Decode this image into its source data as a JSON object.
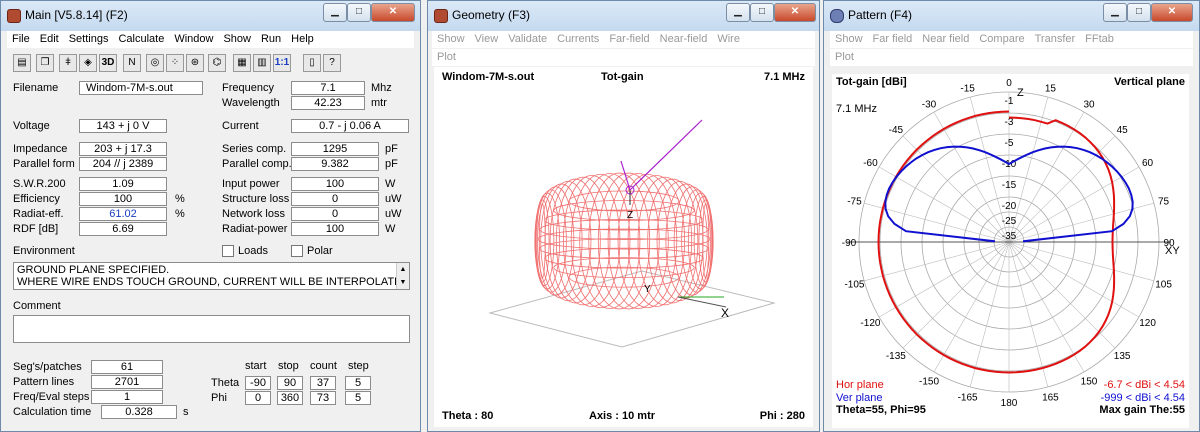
{
  "main": {
    "title": "Main [V5.8.14]  (F2)",
    "menu": [
      "File",
      "Edit",
      "Settings",
      "Calculate",
      "Window",
      "Show",
      "Run",
      "Help"
    ],
    "toolbar_icons": [
      "open-icon",
      "copy-icon",
      "antenna-icon",
      "cube-icon",
      "3d-icon",
      "ng-icon",
      "globe-icon",
      "pattern-icon",
      "target-icon",
      "wire-icon",
      "calc-icon",
      "swr-icon",
      "ratio-icon",
      "book-icon",
      "help-icon"
    ],
    "toolbar_text": {
      "3d": "3D",
      "ratio": "1:1"
    },
    "filename_label": "Filename",
    "filename": "Windom-7M-s.out",
    "frequency_label": "Frequency",
    "frequency": "7.1",
    "frequency_unit": "Mhz",
    "wavelength_label": "Wavelength",
    "wavelength": "42.23",
    "wavelength_unit": "mtr",
    "voltage_label": "Voltage",
    "voltage": "143 + j 0 V",
    "current_label": "Current",
    "current": "0.7 - j 0.06 A",
    "impedance_label": "Impedance",
    "impedance": "203 + j 17.3",
    "series_label": "Series comp.",
    "series": "1295",
    "series_unit": "pF",
    "parallel_form_label": "Parallel form",
    "parallel_form": "204 // j 2389",
    "parallel_comp_label": "Parallel comp.",
    "parallel_comp": "9.382",
    "parallel_comp_unit": "pF",
    "swr_label": "S.W.R.200",
    "swr": "1.09",
    "input_power_label": "Input power",
    "input_power": "100",
    "input_power_unit": "W",
    "efficiency_label": "Efficiency",
    "efficiency": "100",
    "efficiency_unit": "%",
    "structure_loss_label": "Structure loss",
    "structure_loss": "0",
    "structure_loss_unit": "uW",
    "radiat_eff_label": "Radiat-eff.",
    "radiat_eff": "61.02",
    "radiat_eff_unit": "%",
    "network_loss_label": "Network loss",
    "network_loss": "0",
    "network_loss_unit": "uW",
    "rdf_label": "RDF [dB]",
    "rdf": "6.69",
    "radiat_power_label": "Radiat-power",
    "radiat_power": "100",
    "radiat_power_unit": "W",
    "environment_label": "Environment",
    "loads_label": "Loads",
    "polar_label": "Polar",
    "environment_line1": "GROUND PLANE SPECIFIED.",
    "environment_line2": "WHERE WIRE ENDS TOUCH GROUND, CURRENT WILL BE INTERPOLATED",
    "comment_label": "Comment",
    "segs_label": "Seg's/patches",
    "segs": "61",
    "pattern_lines_label": "Pattern lines",
    "pattern_lines": "2701",
    "freq_eval_label": "Freq/Eval steps",
    "freq_eval": "1",
    "calc_time_label": "Calculation time",
    "calc_time": "0.328",
    "calc_time_unit": "s",
    "grid_hdr": {
      "start": "start",
      "stop": "stop",
      "count": "count",
      "step": "step"
    },
    "theta_label": "Theta",
    "theta": {
      "start": "-90",
      "stop": "90",
      "count": "37",
      "step": "5"
    },
    "phi_label": "Phi",
    "phi": {
      "start": "0",
      "stop": "360",
      "count": "73",
      "step": "5"
    }
  },
  "geometry": {
    "title": "Geometry  (F3)",
    "menu": [
      "Show",
      "View",
      "Validate",
      "Currents",
      "Far-field",
      "Near-field",
      "Wire"
    ],
    "menu2": [
      "Plot"
    ],
    "file": "Windom-7M-s.out",
    "mode": "Tot-gain",
    "freq": "7.1 MHz",
    "theta": "Theta : 80",
    "axis": "Axis : 10 mtr",
    "phi": "Phi : 280",
    "axis_x": "X",
    "axis_y": "Y",
    "axis_z": "Z"
  },
  "pattern": {
    "title": "Pattern  (F4)",
    "menu": [
      "Show",
      "Far field",
      "Near field",
      "Compare",
      "Transfer",
      "FFtab"
    ],
    "menu2": [
      "Plot"
    ],
    "header_left": "Tot-gain [dBi]",
    "header_right": "Vertical plane",
    "freq": "7.1 MHz",
    "hor_label": "Hor plane",
    "ver_label": "Ver plane",
    "hor_range": "-6.7 < dBi < 4.54",
    "ver_range": "-999 < dBi < 4.54",
    "bottom_left": "Theta=55, Phi=95",
    "bottom_right": "Max gain The:55",
    "ring_labels": [
      "-1",
      "-3",
      "-5",
      "-10",
      "-15",
      "-20",
      "-25",
      "-35"
    ],
    "angle_labels": [
      "0",
      "15",
      "30",
      "45",
      "60",
      "75",
      "90",
      "105",
      "120",
      "135",
      "150",
      "165",
      "180",
      "-165",
      "-150",
      "-135",
      "-120",
      "-105",
      "-90",
      "-75",
      "-60",
      "-45",
      "-30",
      "-15"
    ],
    "z_label": "Z",
    "xy_label": "XY",
    "colors": {
      "hor": "#e01010",
      "ver": "#1010d0"
    }
  }
}
